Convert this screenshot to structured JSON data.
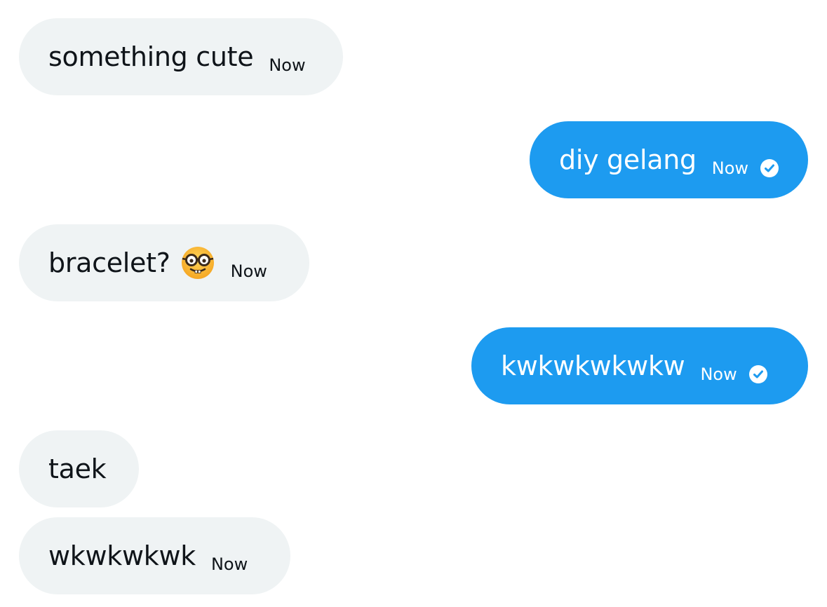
{
  "colors": {
    "incoming_bubble": "#eff3f4",
    "outgoing_bubble": "#1d9bf0",
    "incoming_text": "#0f1419",
    "outgoing_text": "#ffffff"
  },
  "messages": [
    {
      "direction": "incoming",
      "text": "something cute",
      "time": "Now"
    },
    {
      "direction": "outgoing",
      "text": "diy gelang",
      "time": "Now",
      "status_icon": "check-circle-icon"
    },
    {
      "direction": "incoming",
      "text": "bracelet?",
      "emoji": "nerd-face-emoji",
      "time": "Now"
    },
    {
      "direction": "outgoing",
      "text": "kwkwkwkwkw",
      "time": "Now",
      "status_icon": "check-circle-icon"
    },
    {
      "direction": "incoming",
      "text": "taek"
    },
    {
      "direction": "incoming",
      "text": "wkwkwkwk",
      "time": "Now"
    }
  ]
}
